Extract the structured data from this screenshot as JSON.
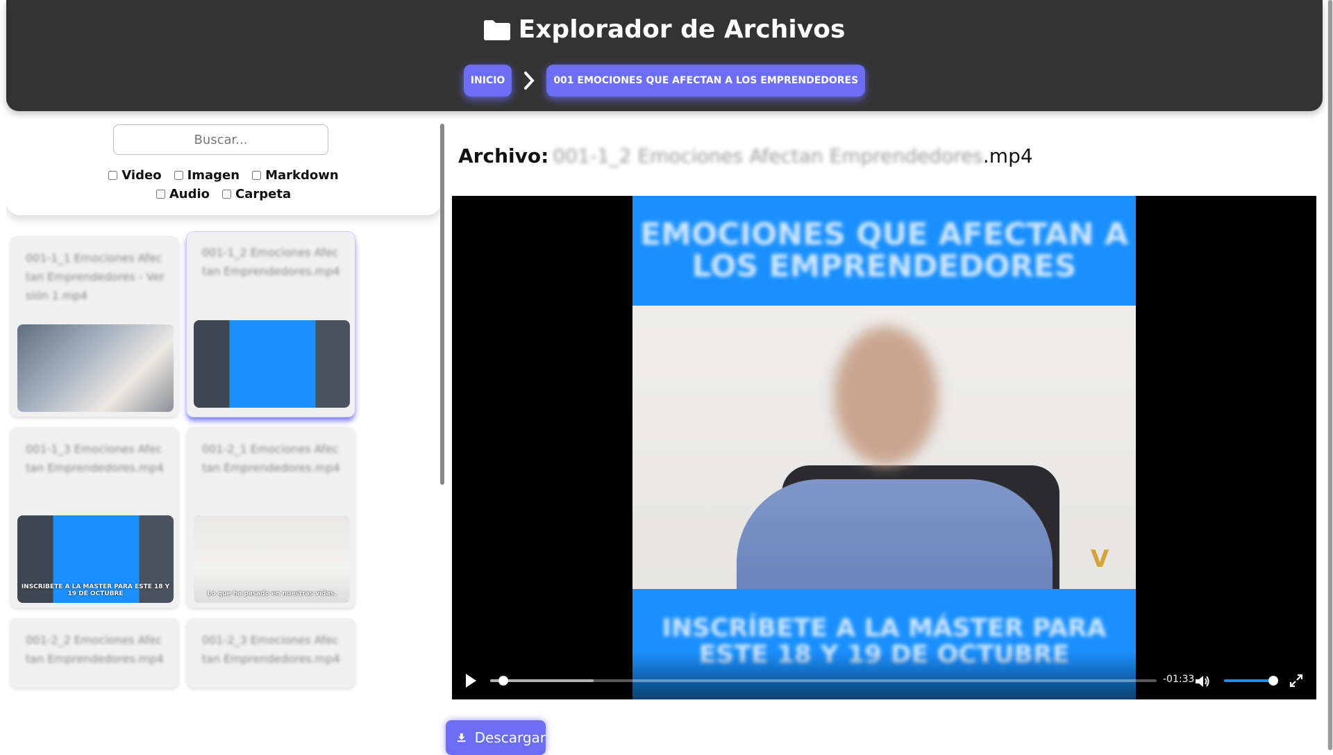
{
  "header": {
    "title": "Explorador de Archivos",
    "breadcrumb": [
      "INICIO",
      "001 EMOCIONES QUE AFECTAN A LOS EMPRENDEDORES"
    ]
  },
  "sidebar": {
    "search_placeholder": "Buscar...",
    "filters_row1": [
      "Video",
      "Imagen",
      "Markdown"
    ],
    "filters_row2": [
      "Audio",
      "Carpeta"
    ],
    "cards": [
      {
        "name": "001-1_1 Emociones Afectan Emprendedores - Versión 1.mp4",
        "thumb": "office",
        "caption": ""
      },
      {
        "name": "001-1_2 Emociones Afectan Emprendedores.mp4",
        "thumb": "blue-mid",
        "caption": ""
      },
      {
        "name": "001-1_3 Emociones Afectan Emprendedores.mp4",
        "thumb": "blue-mid",
        "caption": "INSCRIBETE A LA MASTER PARA ESTE 18 Y 19 DE OCTUBRE"
      },
      {
        "name": "001-2_1 Emociones Afectan Emprendedores.mp4",
        "thumb": "person",
        "caption": "Lo que ha pasado en nuestras vidas."
      },
      {
        "name": "001-2_2 Emociones Afectan Emprendedores.mp4",
        "thumb": "office",
        "caption": ""
      },
      {
        "name": "001-2_3 Emociones Afectan Emprendedores.mp4",
        "thumb": "office",
        "caption": ""
      }
    ]
  },
  "main": {
    "file_label": "Archivo:",
    "file_name_blurred": "001-1_2 Emociones Afectan Emprendedores",
    "file_ext": ".mp4",
    "video": {
      "banner_top": "EMOCIONES QUE AFECTAN A LOS EMPRENDEDORES",
      "banner_bottom": "INSCRÍBETE A LA MÁSTER PARA ESTE 18 Y 19 DE OCTUBRE",
      "time_remaining": "-01:33",
      "progress_fraction": 0.01,
      "volume_fraction": 1.0
    },
    "download_label": "Descargar"
  },
  "colors": {
    "accent": "#6b6ef5",
    "header_bg": "#333333",
    "video_blue": "#1a90ff"
  },
  "icons": [
    "folder-icon",
    "chevron-right-icon",
    "play-icon",
    "volume-icon",
    "fullscreen-icon",
    "download-icon"
  ]
}
